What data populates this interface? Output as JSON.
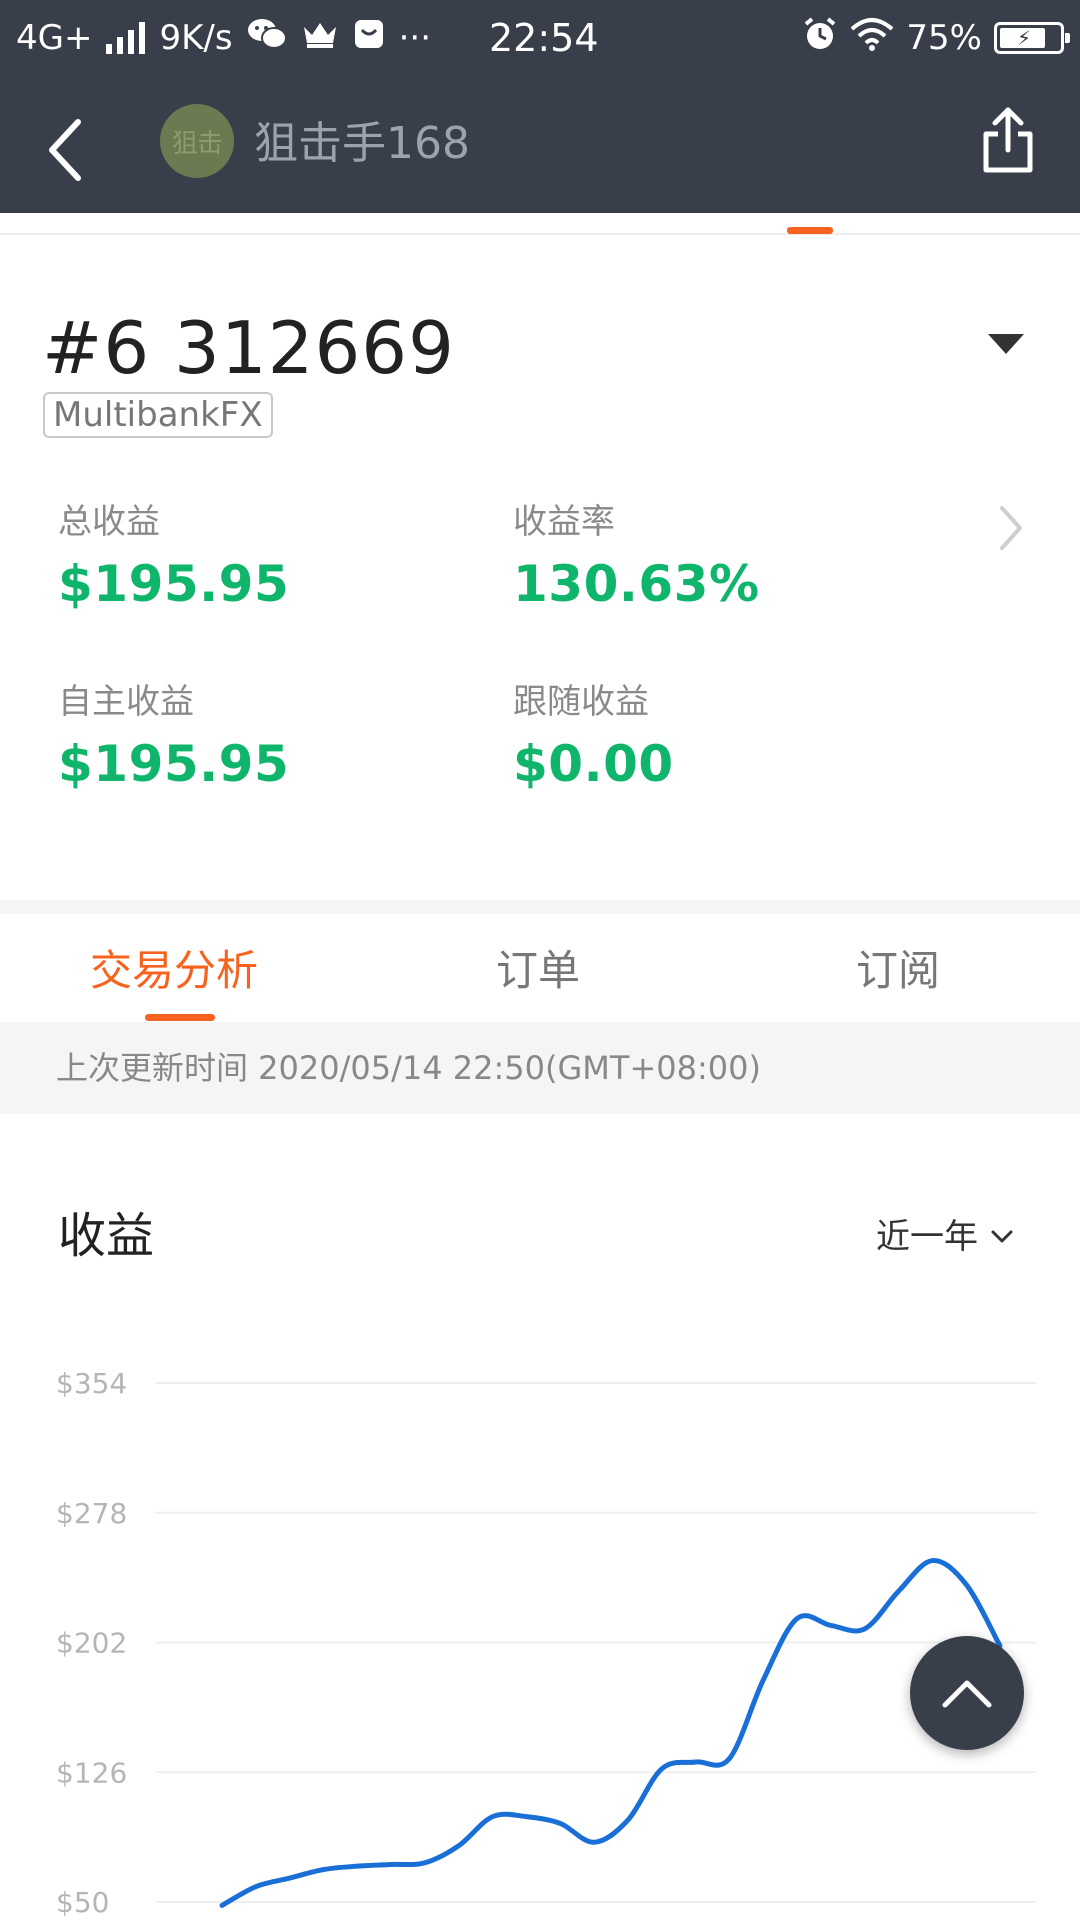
{
  "status_bar": {
    "network": "4G+",
    "speed": "9K/s",
    "more": "···",
    "time": "22:54",
    "battery": "75%"
  },
  "nav": {
    "avatar_text": "狙击",
    "title": "狙击手168"
  },
  "account": {
    "id": "#6 312669",
    "broker": "MultibankFX",
    "stats": [
      {
        "label": "总收益",
        "value": "$195.95"
      },
      {
        "label": "收益率",
        "value": "130.63%"
      },
      {
        "label": "自主收益",
        "value": "$195.95"
      },
      {
        "label": "跟随收益",
        "value": "$0.00"
      }
    ]
  },
  "tabs": [
    {
      "label": "交易分析",
      "active": true
    },
    {
      "label": "订单",
      "active": false
    },
    {
      "label": "订阅",
      "active": false
    }
  ],
  "update_time": "上次更新时间 2020/05/14 22:50(GMT+08:00)",
  "chart_section": {
    "title": "收益",
    "period": "近一年"
  },
  "colors": {
    "header_bg": "#393e4b",
    "accent": "#f7631f",
    "positive": "#0fb56a",
    "line": "#1a6fd6"
  },
  "chart_data": {
    "type": "line",
    "title": "",
    "xlabel": "",
    "ylabel": "",
    "ylim": [
      50,
      354
    ],
    "y_ticks": [
      "$354",
      "$278",
      "$202",
      "$126",
      "$50"
    ],
    "y_tick_values": [
      354,
      278,
      202,
      126,
      50
    ],
    "series": [
      {
        "values": [
          48,
          59,
          64,
          69,
          71,
          72,
          73,
          83,
          100,
          100,
          96,
          85,
          98,
          128,
          132,
          134,
          180,
          216,
          212,
          210,
          232,
          250,
          236,
          200
        ]
      }
    ]
  }
}
